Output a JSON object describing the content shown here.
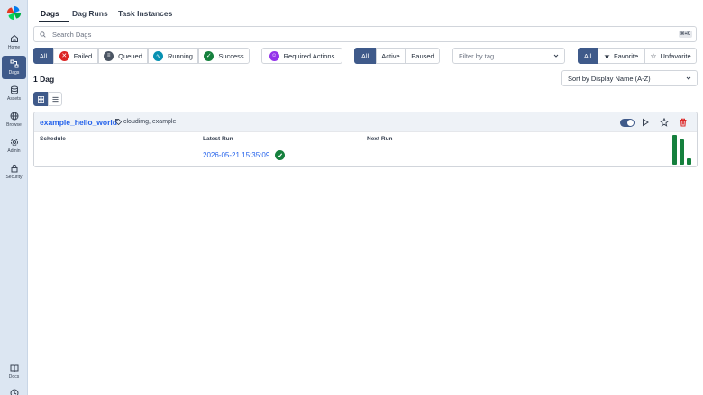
{
  "sidebar": {
    "items": [
      {
        "label": "Home",
        "icon": "home-icon"
      },
      {
        "label": "Dags",
        "icon": "dags-icon",
        "active": true
      },
      {
        "label": "Assets",
        "icon": "database-icon"
      },
      {
        "label": "Browse",
        "icon": "globe-icon"
      },
      {
        "label": "Admin",
        "icon": "gear-icon"
      },
      {
        "label": "Security",
        "icon": "lock-icon"
      },
      {
        "label": "Docs",
        "icon": "book-icon"
      }
    ]
  },
  "tabs": [
    {
      "label": "Dags",
      "active": true
    },
    {
      "label": "Dag Runs"
    },
    {
      "label": "Task Instances"
    }
  ],
  "search": {
    "placeholder": "Search Dags",
    "shortcut": "⌘+K"
  },
  "filters": {
    "state": [
      {
        "label": "All",
        "selected": true
      },
      {
        "label": "Failed",
        "icon": "failed-icon",
        "color": "#dc2626"
      },
      {
        "label": "Queued",
        "icon": "queued-icon",
        "color": "#4b5563"
      },
      {
        "label": "Running",
        "icon": "running-icon",
        "color": "#0891b2"
      },
      {
        "label": "Success",
        "icon": "success-icon",
        "color": "#15803d"
      }
    ],
    "required_actions": {
      "label": "Required Actions",
      "icon": "user-check-icon",
      "color": "#9333ea"
    },
    "paused": [
      {
        "label": "All",
        "selected": true
      },
      {
        "label": "Active"
      },
      {
        "label": "Paused"
      }
    ],
    "tag_placeholder": "Filter by tag",
    "favorite": [
      {
        "label": "All",
        "selected": true
      },
      {
        "label": "Favorite",
        "icon": "star-filled-icon"
      },
      {
        "label": "Unfavorite",
        "icon": "star-outline-icon"
      }
    ]
  },
  "count_label": "1 Dag",
  "sort": {
    "value": "Sort by Display Name (A-Z)"
  },
  "dags": [
    {
      "name": "example_hello_world",
      "tags": "cloudimg, example",
      "active": true,
      "columns": {
        "schedule": "Schedule",
        "latest_run": "Latest Run",
        "next_run": "Next Run"
      },
      "latest_run": "2026-05-21 15:35:09",
      "latest_run_state": "success",
      "recent_runs": [
        {
          "state": "success",
          "duration_ratio": 1.0
        },
        {
          "state": "success",
          "duration_ratio": 0.85
        },
        {
          "state": "success",
          "duration_ratio": 0.22
        }
      ]
    }
  ],
  "colors": {
    "accent": "#3f5a8a",
    "link": "#2563eb",
    "success": "#15803d",
    "failed": "#dc2626"
  }
}
